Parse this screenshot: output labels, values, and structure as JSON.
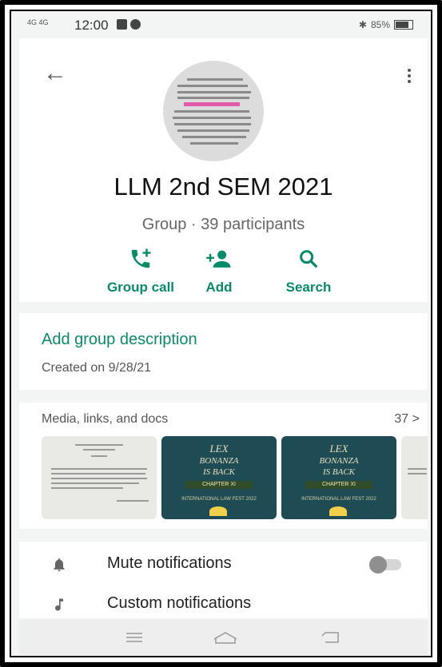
{
  "status_bar": {
    "signal_left": "4G",
    "signal_right": "4G",
    "time": "12:00",
    "right_text": "85%"
  },
  "group": {
    "name": "LLM 2nd SEM 2021",
    "info": "Group · 39 participants"
  },
  "actions": [
    {
      "label": "Group call",
      "icon": "add-call-icon"
    },
    {
      "label": "Add",
      "icon": "add-person-icon"
    },
    {
      "label": "Search",
      "icon": "search-icon"
    }
  ],
  "description": {
    "link": "Add group description",
    "created": "Created on 9/28/21"
  },
  "media": {
    "title": "Media, links, and docs",
    "count": "37 >",
    "poster_text": [
      "LEX",
      "BONANZA",
      "IS BACK"
    ],
    "poster_band": "CHAPTER XI",
    "poster_foot": "INTERNATIONAL LAW FEST 2022"
  },
  "settings": [
    {
      "label": "Mute notifications",
      "icon": "bell-icon",
      "toggle": false
    },
    {
      "label": "Custom notifications",
      "icon": "music-note-icon"
    }
  ],
  "colors": {
    "accent": "#0b8a6a",
    "background": "#f3f4f4"
  }
}
